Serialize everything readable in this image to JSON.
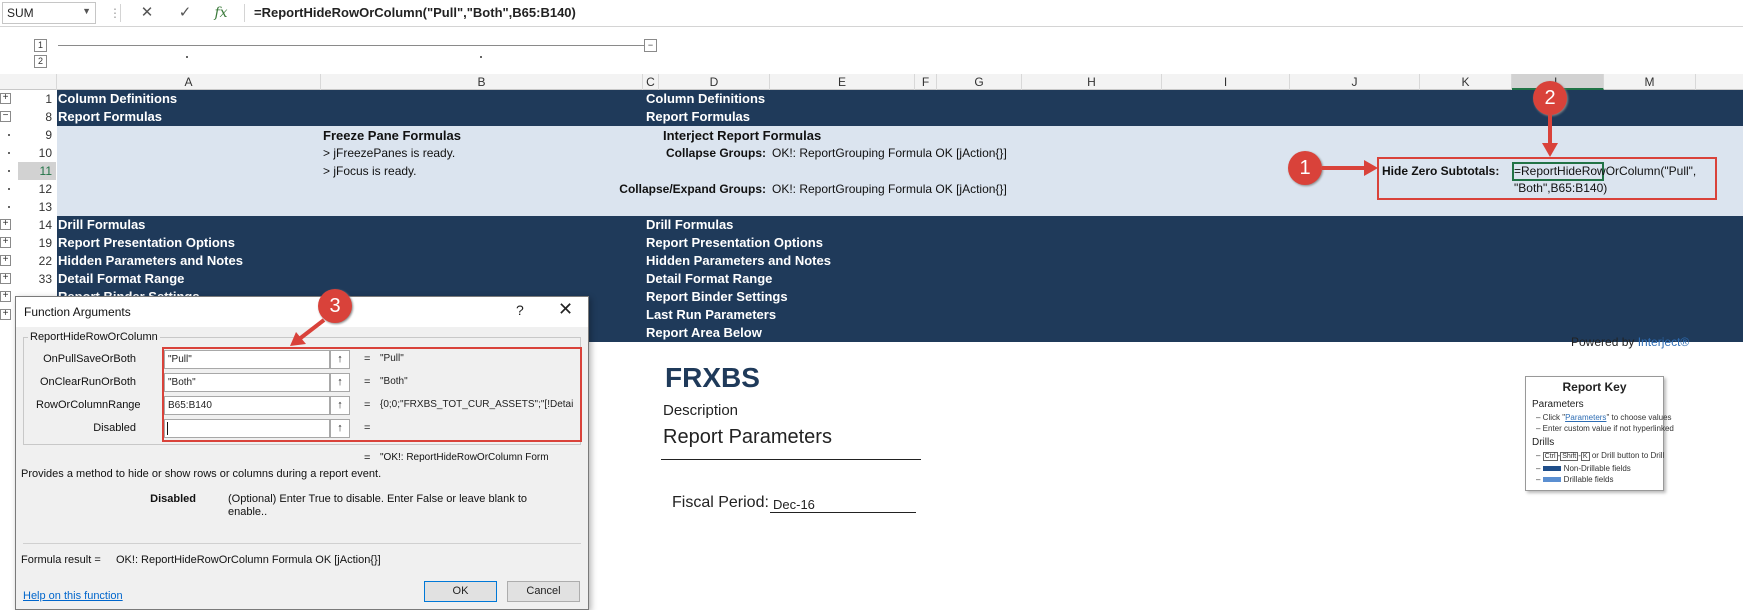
{
  "formula_bar": {
    "name_box": "SUM",
    "cancel_icon": "✕",
    "enter_icon": "✓",
    "fx_label": "fx",
    "formula": "=ReportHideRowOrColumn(\"Pull\",\"Both\",B65:B140)"
  },
  "outline": {
    "levels_top": [
      "1",
      "2"
    ],
    "levels_left": [
      "1",
      "2"
    ],
    "collapse": "−"
  },
  "columns": [
    "A",
    "B",
    "C",
    "D",
    "E",
    "F",
    "G",
    "H",
    "I",
    "J",
    "K",
    "L",
    "M"
  ],
  "rows": [
    "1",
    "8",
    "9",
    "10",
    "11",
    "12",
    "13",
    "14",
    "19",
    "22",
    "33"
  ],
  "sheet": {
    "left_sections": [
      "Column Definitions",
      "Report Formulas",
      "Drill Formulas",
      "Report Presentation Options",
      "Hidden Parameters and Notes",
      "Detail Format Range",
      "Report Binder Settings"
    ],
    "right_sections": [
      "Column Definitions",
      "Report Formulas",
      "Drill Formulas",
      "Report Presentation Options",
      "Hidden Parameters and Notes",
      "Detail Format Range",
      "Report Binder Settings",
      "Last Run Parameters",
      "Report Area Below"
    ],
    "freeze_title": "Freeze Pane Formulas",
    "freeze_lines": [
      "> jFreezePanes is ready.",
      "> jFocus is ready."
    ],
    "interject_title": "Interject Report Formulas",
    "collapse_groups_label": "Collapse Groups:",
    "collapse_groups_value": "OK!: ReportGrouping Formula OK [jAction{}]",
    "collapse_expand_label": "Collapse/Expand Groups:",
    "collapse_expand_value": "OK!: ReportGrouping Formula OK [jAction{}]",
    "hide_zero_label": "Hide Zero Subtotals:",
    "hide_zero_line1": "=ReportHideRowOrColumn(\"Pull\",",
    "hide_zero_line2": "\"Both\",B65:B140)"
  },
  "callouts": [
    "1",
    "2",
    "3"
  ],
  "report": {
    "title": "FRXBS",
    "description": "Description",
    "parameters": "Report Parameters",
    "fiscal_label": "Fiscal Period:",
    "fiscal_value": "Dec-16",
    "powered_prefix": "Powered by",
    "powered_brand": "Interject®",
    "key": {
      "title": "Report Key",
      "parameters": "Parameters",
      "param_item1_pre": "Click \"",
      "param_item1_link": "Parameters",
      "param_item1_post": "\" to choose values",
      "param_item2": "Enter custom value if not hyperlinked",
      "drills": "Drills",
      "drill_k1": "Ctrl",
      "drill_k2": "Shift",
      "drill_k3": "K",
      "drill_item1_post": "or Drill button to Drill",
      "drill_item2": "Non-Drillable fields",
      "drill_item3": "Drillable fields"
    }
  },
  "dialog": {
    "title": "Function Arguments",
    "help": "?",
    "close": "✕",
    "function_name": "ReportHideRowOrColumn",
    "args": [
      {
        "label": "OnPullSaveOrBoth",
        "value": "\"Pull\"",
        "result": "\"Pull\""
      },
      {
        "label": "OnClearRunOrBoth",
        "value": "\"Both\"",
        "result": "\"Both\""
      },
      {
        "label": "RowOrColumnRange",
        "value": "B65:B140",
        "result": "{0;0;\"FRXBS_TOT_CUR_ASSETS\";\"[!Detai"
      },
      {
        "label": "Disabled",
        "value": "",
        "result": ""
      }
    ],
    "up_icon": "↑",
    "equals": "=",
    "overall_result": "\"OK!: ReportHideRowOrColumn Form",
    "description": "Provides a method to hide or show rows or columns during a report event.",
    "param_name": "Disabled",
    "param_desc_line1": "(Optional) Enter True to disable.  Enter False or leave blank to",
    "param_desc_line2": "enable..",
    "formula_result_label": "Formula result =",
    "formula_result_value": "OK!: ReportHideRowOrColumn Formula OK [jAction{}]",
    "help_link": "Help on this function",
    "ok": "OK",
    "cancel": "Cancel"
  },
  "colors": {
    "navy": "#1f3a5a",
    "light_band": "#dbe4ef",
    "callout": "#d9423a",
    "excel_green": "#217346"
  }
}
